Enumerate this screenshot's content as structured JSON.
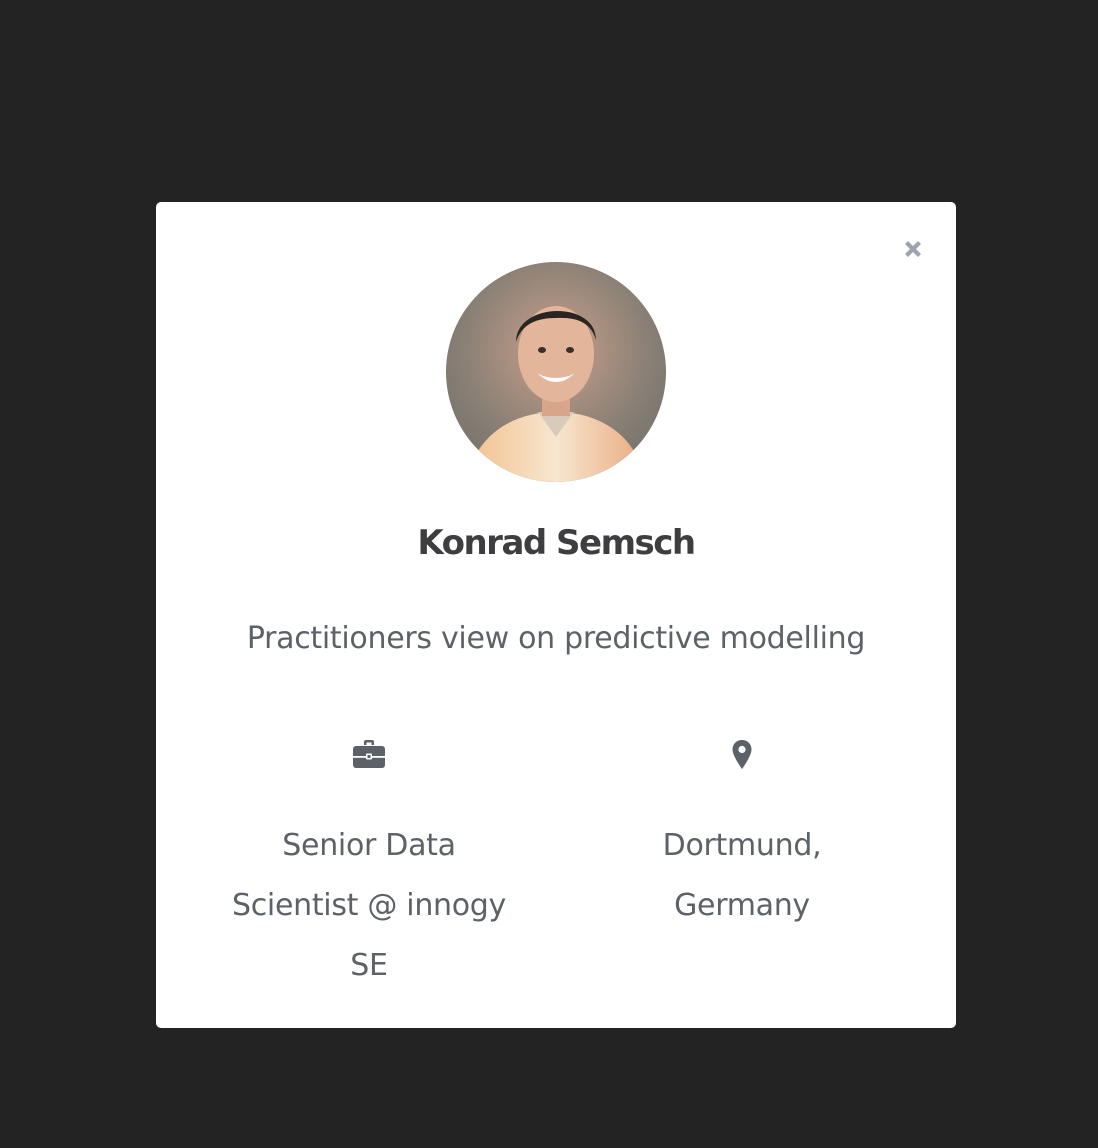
{
  "modal": {
    "close_icon": "close-icon",
    "avatar_alt": "speaker-photo",
    "speaker_name": "Konrad Semsch",
    "talk_title": "Practitioners view on predictive modelling",
    "job": {
      "icon": "briefcase-icon",
      "text": "Senior Data Scientist @ innogy SE"
    },
    "location": {
      "icon": "map-marker-icon",
      "text": "Dortmund, Germany"
    }
  },
  "colors": {
    "backdrop": "#232323",
    "modal_bg": "#ffffff",
    "name_text": "#3e3e40",
    "body_text": "#5d6168",
    "close_icon": "#9ea4ad",
    "info_icon": "#5d6168"
  }
}
